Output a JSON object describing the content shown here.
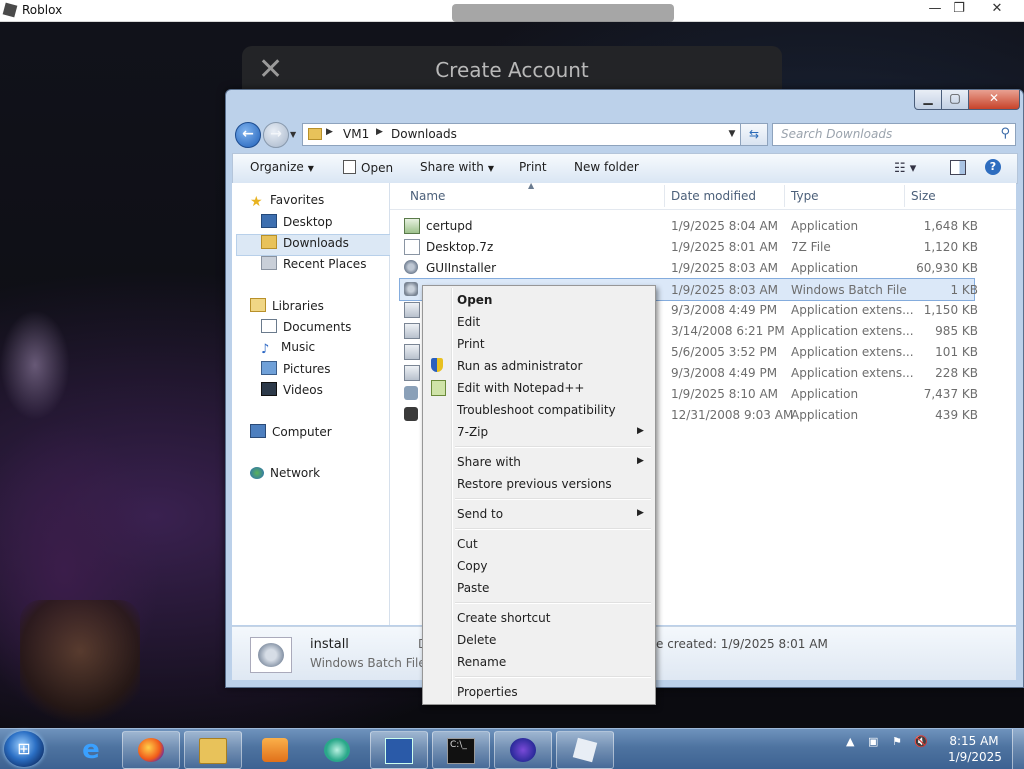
{
  "roblox": {
    "window_title": "Roblox",
    "modal_title": "Create Account",
    "controls": {
      "minimize": "—",
      "restore": "❐",
      "close": "✕"
    }
  },
  "explorer": {
    "address": {
      "root": "VM1",
      "folder": "Downloads"
    },
    "search_placeholder": "Search Downloads",
    "commands": {
      "organize": "Organize",
      "open": "Open",
      "share_with": "Share with",
      "print": "Print",
      "new_folder": "New folder"
    },
    "nav": {
      "favorites": "Favorites",
      "desktop": "Desktop",
      "downloads": "Downloads",
      "recent_places": "Recent Places",
      "libraries": "Libraries",
      "documents": "Documents",
      "music": "Music",
      "pictures": "Pictures",
      "videos": "Videos",
      "computer": "Computer",
      "network": "Network"
    },
    "columns": {
      "name": "Name",
      "date_modified": "Date modified",
      "type": "Type",
      "size": "Size"
    },
    "files": [
      {
        "name": "certupd",
        "date": "1/9/2025 8:04 AM",
        "type": "Application",
        "size": "1,648 KB",
        "icon": "app-icon"
      },
      {
        "name": "Desktop.7z",
        "date": "1/9/2025 8:01 AM",
        "type": "7Z File",
        "size": "1,120 KB",
        "icon": "archive-icon"
      },
      {
        "name": "GUIInstaller",
        "date": "1/9/2025 8:03 AM",
        "type": "Application",
        "size": "60,930 KB",
        "icon": "installer-icon"
      },
      {
        "name": "",
        "date": "1/9/2025 8:03 AM",
        "type": "Windows Batch File",
        "size": "1 KB",
        "icon": "batch-file-icon"
      },
      {
        "name": "",
        "date": "9/3/2008 4:49 PM",
        "type": "Application extens...",
        "size": "1,150 KB",
        "icon": "dll-icon"
      },
      {
        "name": "",
        "date": "3/14/2008 6:21 PM",
        "type": "Application extens...",
        "size": "985 KB",
        "icon": "dll-icon"
      },
      {
        "name": "",
        "date": "5/6/2005 3:52 PM",
        "type": "Application extens...",
        "size": "101 KB",
        "icon": "dll-icon"
      },
      {
        "name": "",
        "date": "9/3/2008 4:49 PM",
        "type": "Application extens...",
        "size": "228 KB",
        "icon": "dll-icon"
      },
      {
        "name": "",
        "date": "1/9/2025 8:10 AM",
        "type": "Application",
        "size": "7,437 KB",
        "icon": "pen-app-icon"
      },
      {
        "name": "",
        "date": "12/31/2008 9:03 AM",
        "type": "Application",
        "size": "439 KB",
        "icon": "wolf-app-icon"
      }
    ],
    "details": {
      "name": "install",
      "type": "Windows Batch File",
      "created_prefix": "D",
      "created": "e created: 1/9/2025 8:01 AM"
    }
  },
  "context_menu": {
    "open": "Open",
    "edit": "Edit",
    "print": "Print",
    "run_as_admin": "Run as administrator",
    "edit_notepadpp": "Edit with Notepad++",
    "troubleshoot": "Troubleshoot compatibility",
    "seven_zip": "7-Zip",
    "share_with": "Share with",
    "restore_previous": "Restore previous versions",
    "send_to": "Send to",
    "cut": "Cut",
    "copy": "Copy",
    "paste": "Paste",
    "create_shortcut": "Create shortcut",
    "delete": "Delete",
    "rename": "Rename",
    "properties": "Properties"
  },
  "taskbar": {
    "time": "8:15 AM",
    "date": "1/9/2025",
    "cmd_glyph": "C:\\_"
  }
}
